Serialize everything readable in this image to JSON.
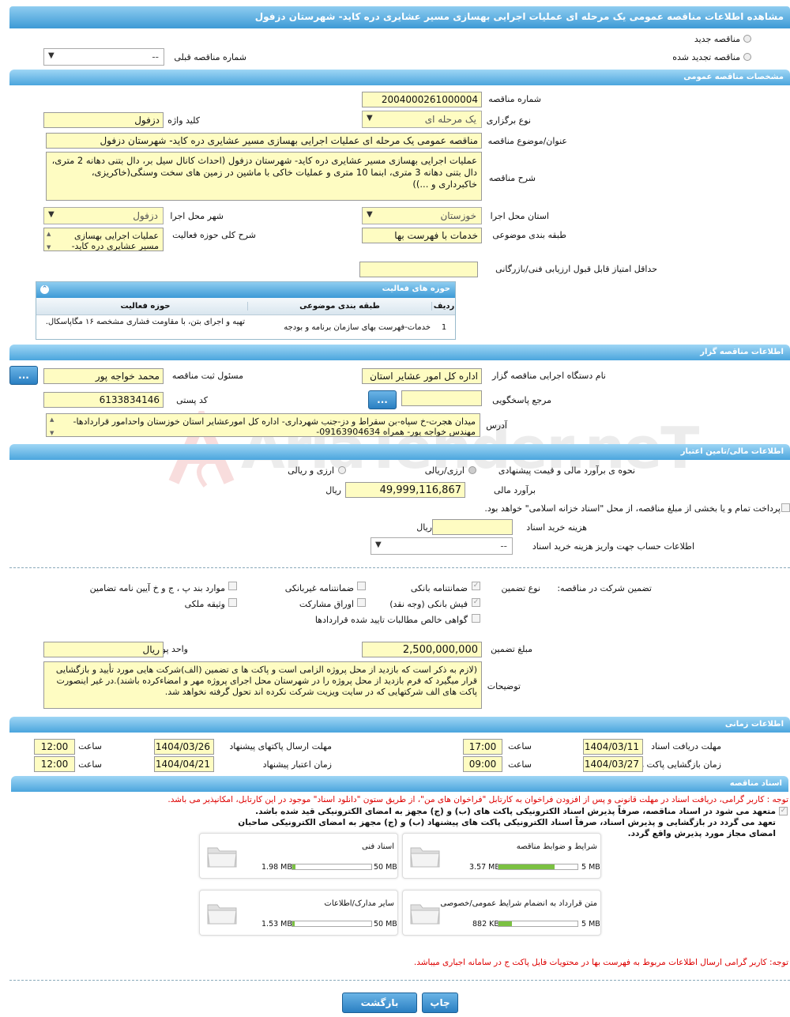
{
  "title": "مشاهده اطلاعات مناقصه عمومی یک مرحله ای عملیات اجرایی بهسازی مسیر عشایری دره کاید- شهرستان دزفول",
  "top": {
    "new_tender": "مناقصه جدید",
    "renewed_tender": "مناقصه تجدید شده",
    "prev_number_label": "شماره مناقصه قبلی",
    "prev_number_value": "--"
  },
  "general": {
    "header": "مشخصات مناقصه عمومی",
    "number_label": "شماره مناقصه",
    "number_value": "2004000261000004",
    "type_label": "نوع برگزاری",
    "type_value": "یک مرحله ای",
    "keyword_label": "کلید واژه",
    "keyword_value": "دزفول",
    "subject_label": "عنوان/موضوع مناقصه",
    "subject_value": "مناقصه عمومی یک مرحله ای عملیات اجرایی  بهسازی مسیر عشایری دره کاید- شهرستان دزفول",
    "desc_label": "شرح مناقصه",
    "desc_value": "عملیات اجرایی  بهسازی مسیر عشایری دره کاید- شهرستان دزفول (احداث کانال سیل بر، دال بتنی دهانه 2 متری، دال بتنی دهانه 3 متری، ابنما 10 متری و عملیات خاکی با ماشین در زمین های سخت وسنگی(خاکریزی، خاکبرداری و ...))",
    "province_label": "استان محل اجرا",
    "province_value": "خوزستان",
    "city_label": "شهر محل اجرا",
    "city_value": "دزفول",
    "category_label": "طبقه بندی موضوعی",
    "category_value": "خدمات با فهرست بها",
    "activity_desc_label": "شرح کلی حوزه فعالیت",
    "activity_desc_value": "عملیات اجرایی  بهسازی مسیر عشایری دره کاید-",
    "min_score_label": "حداقل امتیاز قابل قبول ارزیابی فنی/بازرگانی",
    "min_score_value": ""
  },
  "activity_grid": {
    "title": "حوزه های فعالیت",
    "headers": [
      "ردیف",
      "طبقه بندی موضوعی",
      "حوزه فعالیت"
    ],
    "rows": [
      [
        "1",
        "خدمات-فهرست بهای سازمان برنامه و بودجه",
        "تهیه و اجرای بتن، با مقاومت فشاری مشخصه ۱۶ مگاپاسکال."
      ]
    ]
  },
  "organizer": {
    "header": "اطلاعات مناقصه گزار",
    "agency_label": "نام دستگاه اجرایی مناقصه گزار",
    "agency_value": "اداره کل امور عشایر استان",
    "registrar_label": "مسئول ثبت مناقصه",
    "registrar_value": "محمد خواجه پور",
    "ref_label": "مرجع پاسخگویی",
    "ref_value": "",
    "postal_label": "کد پستی",
    "postal_value": "6133834146",
    "address_label": "آدرس",
    "address_value": "میدان هجرت-خ سپاه-بن سقراط و دز-جنب شهرداری- اداره کل امورعشایر استان خوزستان واحدامور قراردادها- مهندس خواجه پور- همراه 09163904634-",
    "dots": "..."
  },
  "finance": {
    "header": "اطلاعات مالی/تامین اعتبار",
    "method_label": "نحوه ی برآورد مالی و قیمت پیشنهادی",
    "opt1": "ارزی/ریالی",
    "opt2": "ارزی و ریالی",
    "estimate_label": "برآورد مالی",
    "estimate_value": "49,999,116,867",
    "rial": "ریال",
    "treasury_text": "پرداخت تمام و یا بخشی از مبلغ مناقصه، از محل \"اسناد خزانه اسلامی\" خواهد بود.",
    "doc_fee_label": "هزینه خرید اسناد",
    "doc_fee_value": "",
    "account_label": "اطلاعات حساب جهت واریز هزینه خرید اسناد",
    "account_value": "--"
  },
  "guarantee": {
    "label": "تضمین شرکت در مناقصه:",
    "type_label": "نوع تضمین",
    "options": {
      "bank_guarantee": "ضمانتنامه بانکی",
      "non_bank": "ضمانتنامه غیربانکی",
      "article": "موارد بند پ ، ج و خ آیین نامه تضامین",
      "cash": "فیش بانکی (وجه نقد)",
      "bonds": "اوراق مشارکت",
      "property": "وثیقه ملکی",
      "claims": "گواهی خالص مطالبات تایید شده قراردادها"
    },
    "amount_label": "مبلغ تضمین",
    "amount_value": "2,500,000,000",
    "currency_label": "واحد پول",
    "currency_value": "ریال",
    "notes_label": "توضیحات",
    "notes_value": "(لازم به ذکر است که بازدید از محل پروژه الزامی است و پاکت ها ی تضمین (الف)شرکت هایی مورد تأیید و بازگشایی قرار میگیرد که فرم بازدید از محل پروژه را در شهرستان محل اجرای پروژه مهر و امضاءکرده باشند).در غیر اینصورت پاکت های الف شرکتهایی که در سایت ویزیت شرکت نکرده اند تحول گرفته نخواهد شد."
  },
  "timing": {
    "header": "اطلاعات زمانی",
    "doc_receive_label": "مهلت دریافت اسناد",
    "doc_receive_date": "1404/03/11",
    "doc_receive_time": "17:00",
    "send_label": "مهلت ارسال پاکتهای پیشنهاد",
    "send_date": "1404/03/26",
    "send_time": "12:00",
    "open_label": "زمان بازگشایی پاکت ها",
    "open_date": "1404/03/27",
    "open_time": "09:00",
    "validity_label": "زمان اعتبار پیشنهاد",
    "validity_date": "1404/04/21",
    "validity_time": "12:00",
    "time_label": "ساعت"
  },
  "documents": {
    "header": "اسناد مناقصه",
    "notice1": "توجه : کاربر گرامی، دریافت اسناد در مهلت قانونی و پس از افزودن فراخوان به کارتابل \"فراخوان های من\"، از طریق ستون \"دانلود اسناد\" موجود در این کارتابل، امکانپذیر می باشد.",
    "commit": "متعهد می شود در اسناد مناقصه، صرفاً پذیرش اسناد الکترونیکی پاکت های (ب) و (ج) مجهز به امضای الکترونیکی قید شده باشد. تعهد می گردد در بازگشایی و پذیرش اسناد، صرفاً اسناد الکترونیکی پاکت های پیشنهاد (ب) و (ج) مجهز به امضای الکترونیکی صاحبان امضای مجاز مورد پذیرش واقع گردد.",
    "files": [
      {
        "name": "شرایط و ضوابط مناقصه",
        "size": "3.57 MB",
        "max": "5 MB",
        "fraction": 0.714
      },
      {
        "name": "اسناد فنی",
        "size": "1.98 MB",
        "max": "50 MB",
        "fraction": 0.04
      },
      {
        "name": "متن قرارداد به انضمام شرایط عمومی/خصوصی",
        "size": "882 KB",
        "max": "5 MB",
        "fraction": 0.17
      },
      {
        "name": "سایر مدارک/اطلاعات",
        "size": "1.53 MB",
        "max": "50 MB",
        "fraction": 0.03
      }
    ],
    "notice2": "توجه: کاربر گرامی ارسال اطلاعات مربوط به فهرست بها در محتویات فایل پاکت ج در سامانه اجباری میباشد."
  },
  "buttons": {
    "back": "بازگشت",
    "print": "چاپ"
  },
  "watermark": "AriaTender.neT"
}
